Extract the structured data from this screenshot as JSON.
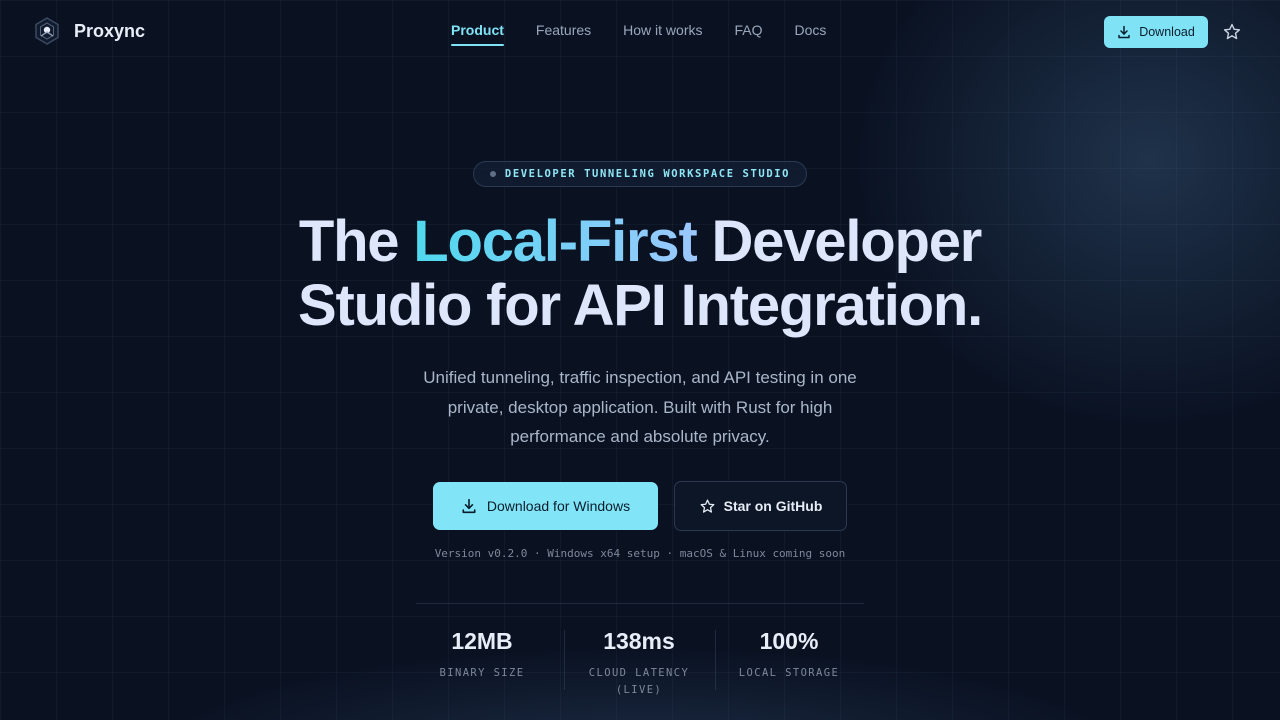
{
  "colors": {
    "background": "#0a1222",
    "accent": "#7fe3f5",
    "accent_gradient_end": "#9cc8ff",
    "text_primary": "#dde6fb",
    "text_muted": "#a9b6c8"
  },
  "brand": {
    "name": "Proxync",
    "logo_icon": "hexagon-logo-icon"
  },
  "nav": {
    "links": [
      {
        "label": "Product",
        "active": true
      },
      {
        "label": "Features",
        "active": false
      },
      {
        "label": "How it works",
        "active": false
      },
      {
        "label": "FAQ",
        "active": false
      },
      {
        "label": "Docs",
        "active": false
      }
    ],
    "download_label": "Download",
    "download_icon": "download-icon",
    "star_icon": "star-icon"
  },
  "badge": {
    "text": "DEVELOPER TUNNELING WORKSPACE STUDIO"
  },
  "hero": {
    "title_part1": "The ",
    "title_accent": "Local-First",
    "title_part2": " Developer",
    "title_line2": "Studio for API Integration.",
    "subtitle": "Unified tunneling, traffic inspection, and API testing in one private, desktop application. Built with Rust for high performance and absolute privacy."
  },
  "cta": {
    "primary_label": "Download for Windows",
    "primary_icon": "download-icon",
    "secondary_label": "Star on GitHub",
    "secondary_icon": "star-icon",
    "version_line": "Version v0.2.0 · Windows x64 setup · macOS & Linux coming soon"
  },
  "stats": [
    {
      "value": "12MB",
      "label": "BINARY SIZE"
    },
    {
      "value": "138ms",
      "label": "CLOUD LATENCY (LIVE)"
    },
    {
      "value": "100%",
      "label": "LOCAL STORAGE"
    }
  ]
}
